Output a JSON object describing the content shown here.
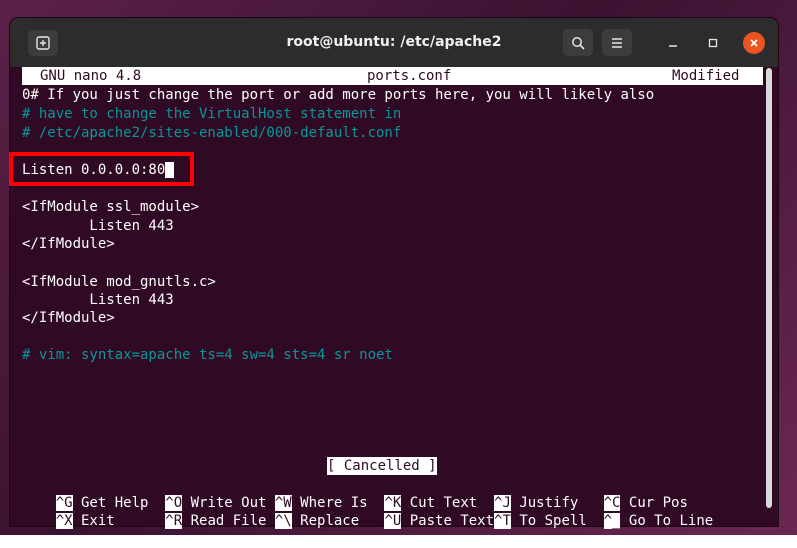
{
  "window": {
    "title": "root@ubuntu: /etc/apache2",
    "icons": {
      "new_tab": "new-tab-icon",
      "search": "search-icon",
      "menu": "hamburger-menu-icon",
      "minimize": "minimize-icon",
      "maximize": "maximize-icon",
      "close": "close-icon"
    },
    "colors": {
      "terminal_bg": "#300a24",
      "close": "#e95420",
      "comment": "#06989a",
      "highlight": "#ff0000"
    }
  },
  "nano": {
    "version": "GNU nano 4.8",
    "filename": "ports.conf",
    "state": "Modified"
  },
  "content": {
    "line1": "0# If you just change the port or add more ports here, you will likely also",
    "line2": "# have to change the VirtualHost statement in",
    "line3": "# /etc/apache2/sites-enabled/000-default.conf",
    "listen": "Listen 0.0.0.0:80",
    "ssl_open": "<IfModule ssl_module>",
    "ssl_listen": "        Listen 443",
    "ssl_close": "</IfModule>",
    "gnutls_open": "<IfModule mod_gnutls.c>",
    "gnutls_listen": "        Listen 443",
    "gnutls_close": "</IfModule>",
    "modeline": "# vim: syntax=apache ts=4 sw=4 sts=4 sr noet"
  },
  "status_message": "[ Cancelled ]",
  "shortcuts_row1": [
    {
      "key": "^G",
      "label": " Get Help  "
    },
    {
      "key": "^O",
      "label": " Write Out "
    },
    {
      "key": "^W",
      "label": " Where Is  "
    },
    {
      "key": "^K",
      "label": " Cut Text  "
    },
    {
      "key": "^J",
      "label": " Justify   "
    },
    {
      "key": "^C",
      "label": " Cur Pos"
    }
  ],
  "shortcuts_row2": [
    {
      "key": "^X",
      "label": " Exit      "
    },
    {
      "key": "^R",
      "label": " Read File "
    },
    {
      "key": "^\\",
      "label": " Replace   "
    },
    {
      "key": "^U",
      "label": " Paste Text"
    },
    {
      "key": "^T",
      "label": " To Spell  "
    },
    {
      "key": "^_",
      "label": " Go To Line"
    }
  ]
}
